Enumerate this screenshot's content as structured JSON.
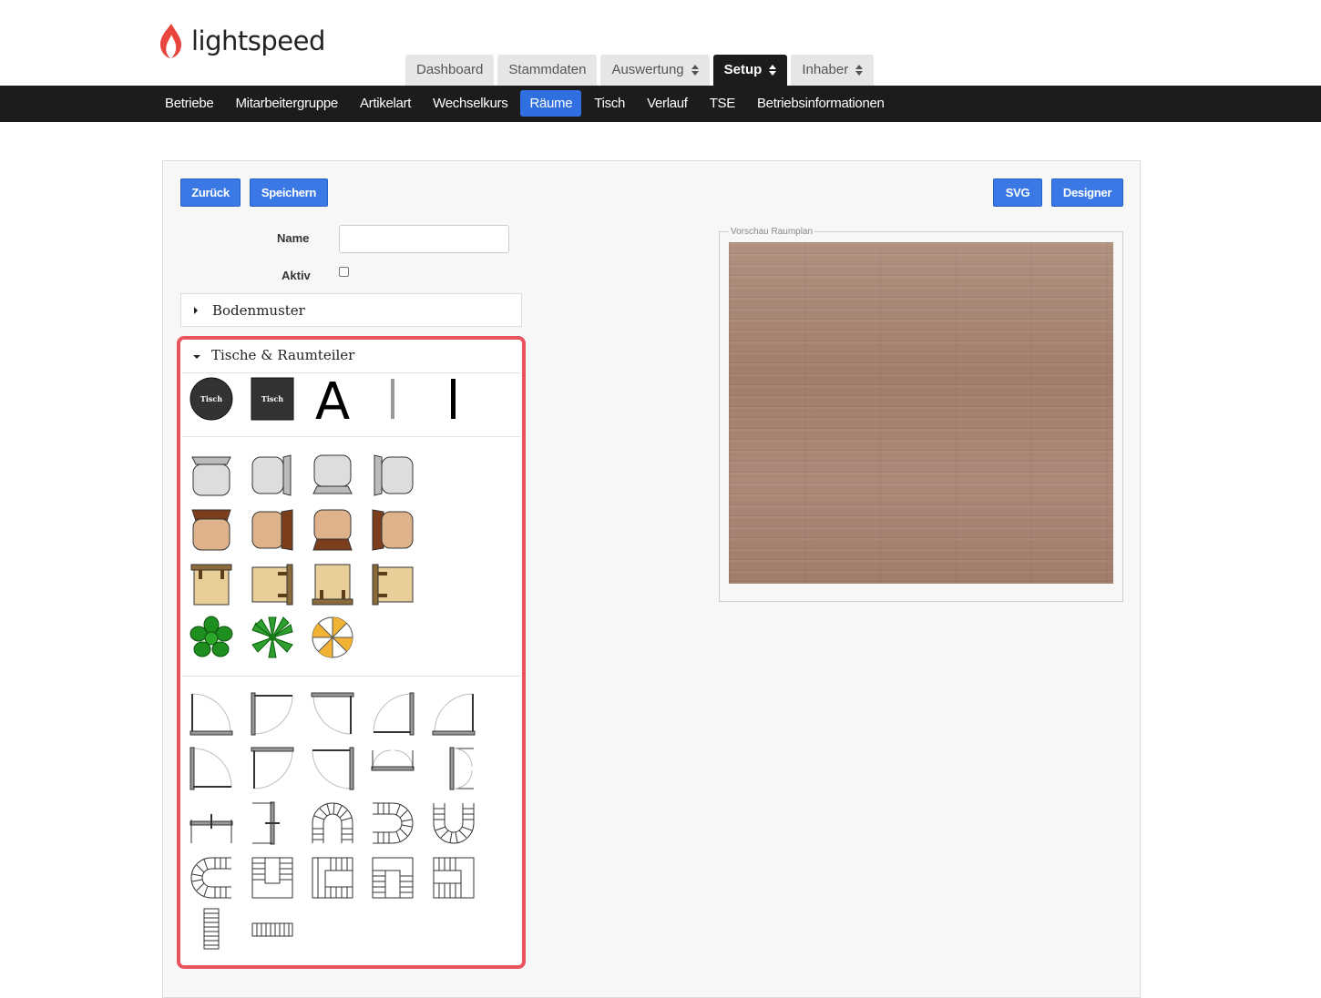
{
  "brand": {
    "name": "lightspeed",
    "color": "#e8453c"
  },
  "main_tabs": [
    {
      "label": "Dashboard",
      "sortable": false
    },
    {
      "label": "Stammdaten",
      "sortable": false
    },
    {
      "label": "Auswertung",
      "sortable": true
    },
    {
      "label": "Setup",
      "sortable": true,
      "active": true
    },
    {
      "label": "Inhaber",
      "sortable": true
    }
  ],
  "sub_nav": [
    "Betriebe",
    "Mitarbeitergruppe",
    "Artikelart",
    "Wechselkurs",
    "Räume",
    "Tisch",
    "Verlauf",
    "TSE",
    "Betriebsinformationen"
  ],
  "sub_nav_active": "Räume",
  "buttons": {
    "back": "Zurück",
    "save": "Speichern",
    "svg": "SVG",
    "designer": "Designer"
  },
  "form": {
    "name_label": "Name",
    "name_value": "",
    "active_label": "Aktiv",
    "active_checked": false
  },
  "accordions": {
    "floor_pattern": "Bodenmuster",
    "tables": "Tische & Raumteiler"
  },
  "tables_section": {
    "round_table_label": "Tisch",
    "square_table_label": "Tisch",
    "text_tool": "A"
  },
  "preview": {
    "legend": "Vorschau Raumplan"
  },
  "colors": {
    "accent": "#3a78e6",
    "nav_bg": "#1c1c1c",
    "highlight": "#e8555e",
    "floor": "#a98676"
  }
}
